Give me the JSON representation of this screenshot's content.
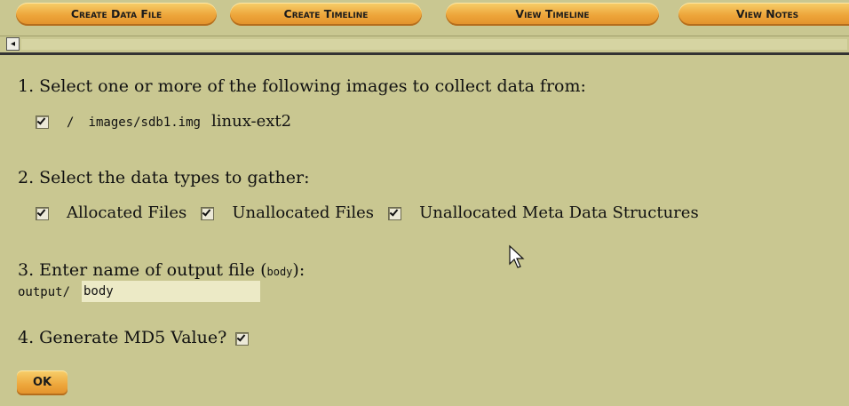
{
  "tabs": [
    {
      "label": "Create Data File"
    },
    {
      "label": "Create Timeline"
    },
    {
      "label": "View Timeline"
    },
    {
      "label": "View Notes"
    }
  ],
  "scroll": {
    "left_arrow": "◂"
  },
  "step1": {
    "prompt": "1. Select one or more of the following images to collect data from:",
    "images": [
      {
        "mount": "/",
        "path": "images/sdb1.img",
        "fstype": "linux-ext2",
        "checked": true
      }
    ]
  },
  "step2": {
    "prompt": "2. Select the data types to gather:",
    "types": [
      {
        "label": "Allocated Files",
        "checked": true
      },
      {
        "label": "Unallocated Files",
        "checked": true
      },
      {
        "label": "Unallocated Meta Data Structures",
        "checked": true
      }
    ]
  },
  "step3": {
    "prompt": "3. Enter name of output file",
    "paren_open": "(",
    "body_word": "body",
    "paren_close": "):",
    "prefix": "output/",
    "value": "body"
  },
  "step4": {
    "prompt": "4. Generate MD5 Value?",
    "checked": true
  },
  "ok_button": "OK",
  "colors": {
    "background": "#c9c791",
    "button": "#eda53a",
    "input": "#eceac6"
  }
}
